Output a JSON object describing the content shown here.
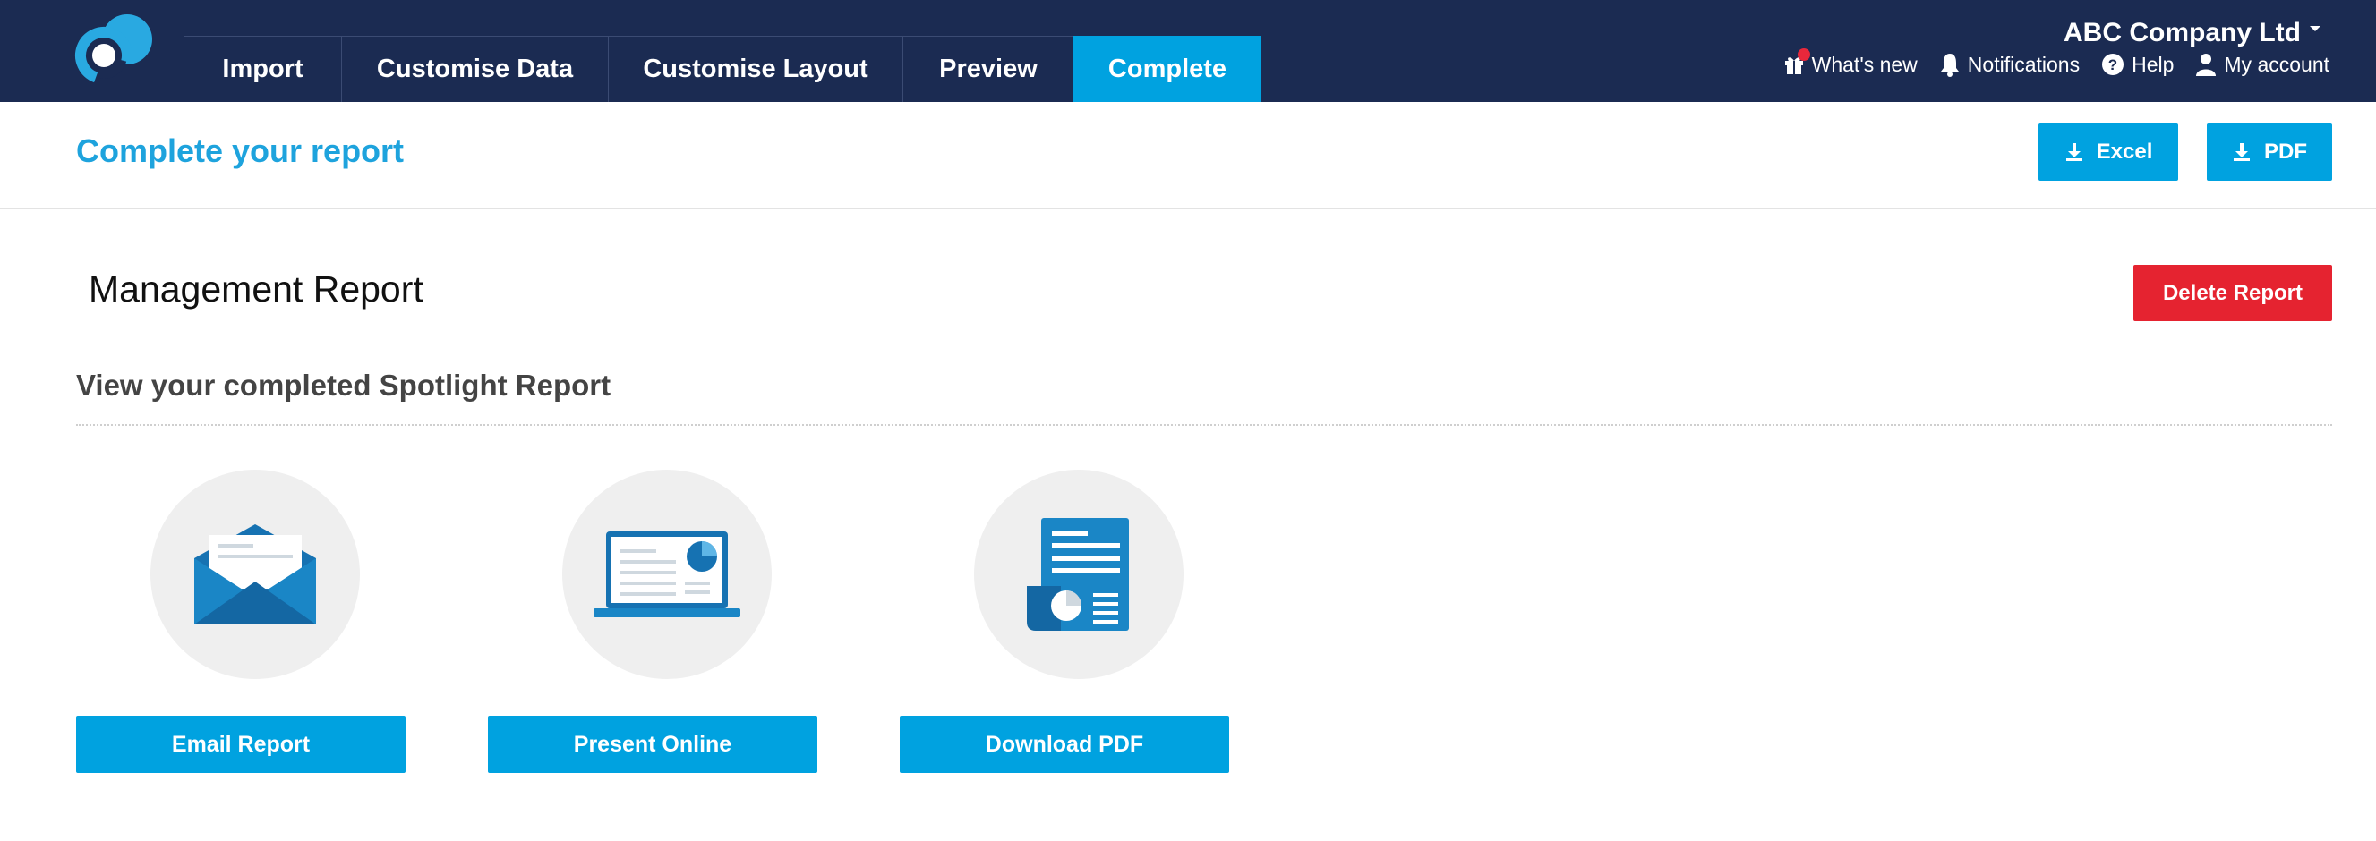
{
  "app": {
    "logo_icon": "spotlight-logo-icon",
    "tabs": [
      {
        "label": "Import",
        "active": false
      },
      {
        "label": "Customise Data",
        "active": false
      },
      {
        "label": "Customise Layout",
        "active": false
      },
      {
        "label": "Preview",
        "active": false
      },
      {
        "label": "Complete",
        "active": true
      }
    ],
    "company": "ABC Company Ltd",
    "utilities": {
      "whats_new": "What's new",
      "notifications": "Notifications",
      "help": "Help",
      "account": "My account"
    }
  },
  "header": {
    "title": "Complete your report",
    "excel_label": "Excel",
    "pdf_label": "PDF"
  },
  "main": {
    "report_name": "Management Report",
    "delete_label": "Delete Report",
    "section_title": "View your completed Spotlight Report",
    "options": [
      {
        "label": "Email Report",
        "icon": "envelope-icon"
      },
      {
        "label": "Present Online",
        "icon": "laptop-icon"
      },
      {
        "label": "Download PDF",
        "icon": "document-icon"
      }
    ]
  },
  "colors": {
    "nav_bg": "#1b2b52",
    "accent": "#00a2e0",
    "danger": "#e52330",
    "title_blue": "#1ea3dd",
    "badge_red": "#e8283b"
  }
}
